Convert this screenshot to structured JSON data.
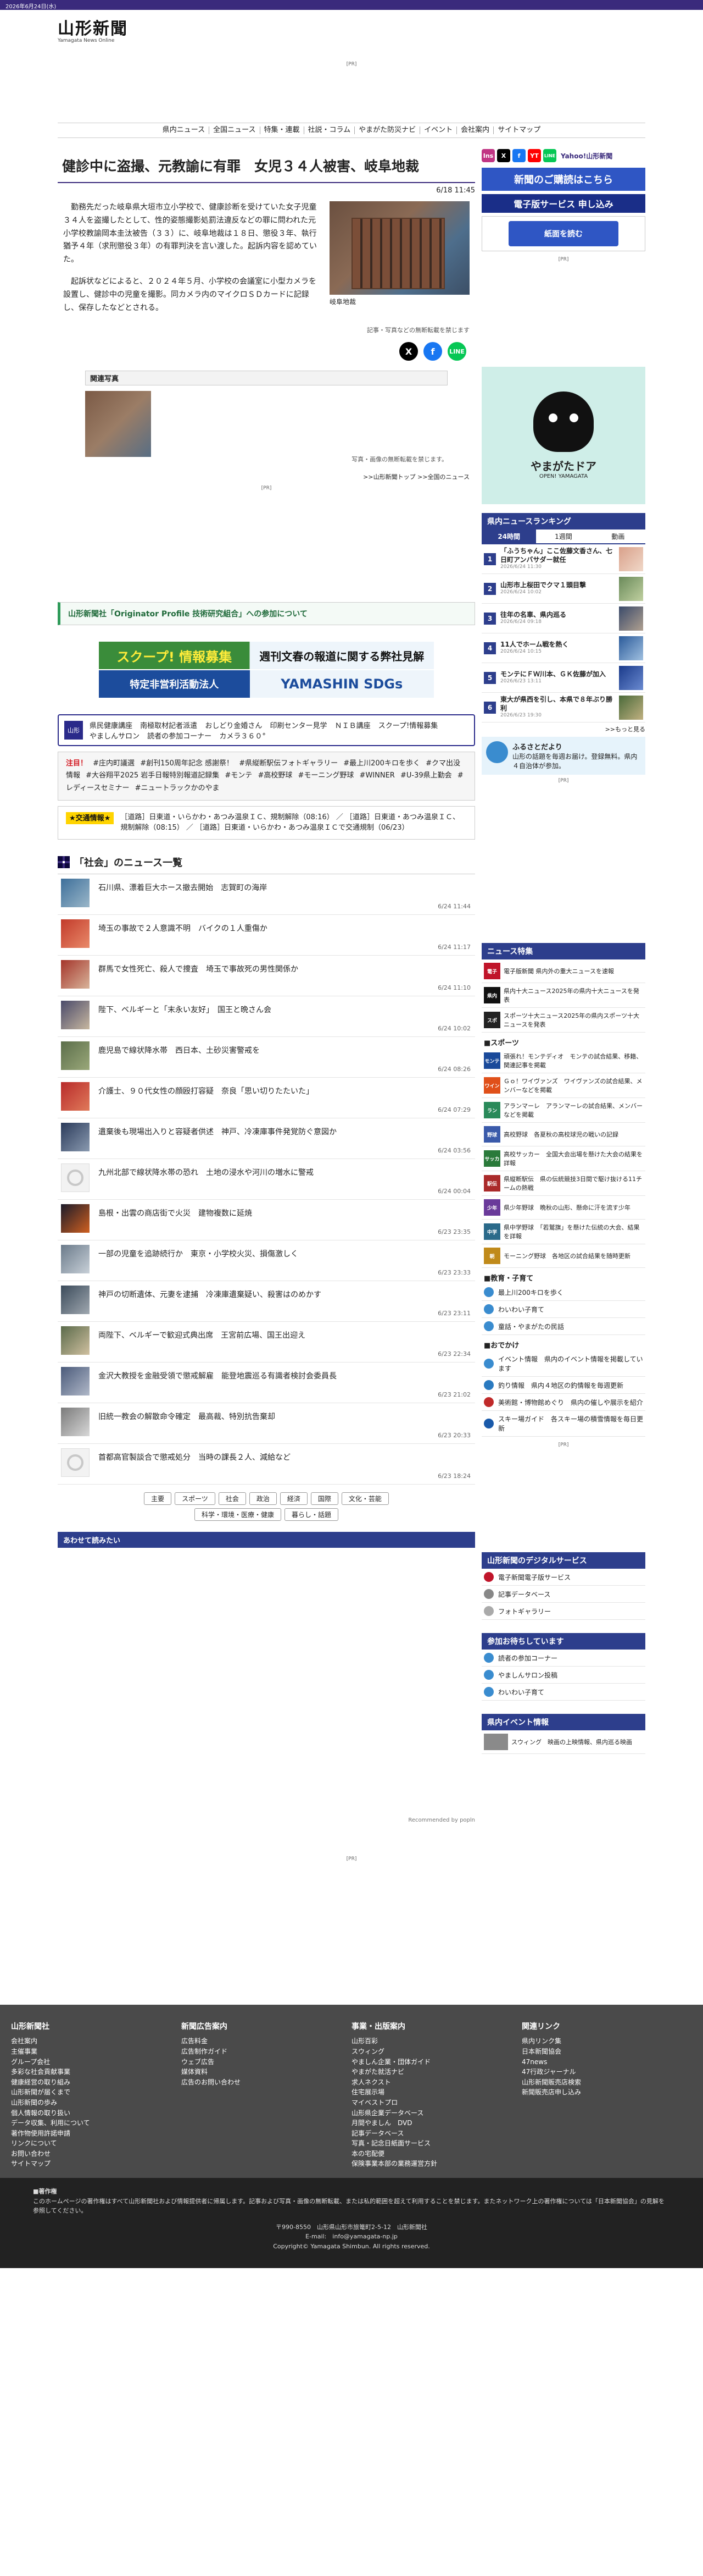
{
  "topbar": {
    "date": "2026年6月24日(水)"
  },
  "masthead": {
    "logo": "山形新聞",
    "logo_sub": "Yamagata News Online"
  },
  "pr_label": "[PR]",
  "nav": [
    "県内ニュース",
    "全国ニュース",
    "特集・連載",
    "社説・コラム",
    "やまがた防災ナビ",
    "イベント",
    "会社案内",
    "サイトマップ"
  ],
  "article": {
    "title": "健診中に盗撮、元教諭に有罪　女児３４人被害、岐阜地裁",
    "date": "6/18 11:45",
    "paragraphs": [
      "勤務先だった岐阜県大垣市立小学校で、健康診断を受けていた女子児童３４人を盗撮したとして、性的姿態撮影処罰法違反などの罪に問われた元小学校教諭岡本圭汰被告（３３）に、岐阜地裁は１８日、懲役３年、執行猶予４年（求刑懲役３年）の有罪判決を言い渡した。起訴内容を認めていた。",
      "起訴状などによると、２０２４年５月、小学校の会議室に小型カメラを設置し、健診中の児童を撮影。同カメラ内のマイクロＳＤカードに記録し、保存したなどとされる。"
    ],
    "photo_caption": "岐阜地裁",
    "photo_note": "記事・写真などの無断転載を禁じます"
  },
  "related": {
    "head": "関連写真",
    "note": "写真・画像の無断転載を禁じます。",
    "back": ">>山形新聞トップ >>全国のニュース"
  },
  "notice": "山形新聞社「Originator Profile 技術研究組合」への参加について",
  "banner1": {
    "left": "スクープ! 情報募集",
    "right": "週刊文春の報道に関する弊社見解"
  },
  "banner2": {
    "left": "特定非営利活動法人",
    "right": "YAMASHIN SDGs"
  },
  "service_box": {
    "icon": "山形",
    "links": [
      "県民健康講座",
      "南極取材記者派遣",
      "おしどり金婚さん",
      "印刷センター見学",
      "ＮＩＢ講座",
      "スクープ!情報募集",
      "やましんサロン",
      "読者の参加コーナー",
      "カメラ３６０°"
    ]
  },
  "tags": {
    "hot": "注目！",
    "items": [
      "#庄内町議選",
      "#創刊150周年記念 感謝祭！",
      "#県縦断駅伝フォトギャラリー",
      "#最上川200キロを歩く",
      "#クマ出没情報",
      "#大谷翔平2025 岩手日報特別報道記録集",
      "#モンテ",
      "#高校野球",
      "#モーニング野球",
      "#WINNER",
      "#U-39県上勤会",
      "#レディースセミナー",
      "#ニュートラックかのやま"
    ]
  },
  "traffic": {
    "label": "★交通情報★",
    "text": "［道路］日東道・いらかわ・あつみ温泉ＩＣ、規制解除（08:16） ／ ［道路］日東道・あつみ温泉ＩＣ、規制解除（08:15） ／ ［道路］日東道・いらかわ・あつみ温泉ＩＣで交通規制（06/23）"
  },
  "newslist": {
    "head": "「社会」のニュース一覧",
    "items": [
      {
        "title": "石川県、漂着巨大ホース撤去開始　志賀町の海岸",
        "date": "6/24 11:44"
      },
      {
        "title": "埼玉の事故で２人意識不明　バイクの１人重傷か",
        "date": "6/24 11:17"
      },
      {
        "title": "群馬で女性死亡、殺人で捜査　埼玉で事故死の男性関係か",
        "date": "6/24 11:10"
      },
      {
        "title": "陛下、ベルギーと「末永い友好」　国王と晩さん会",
        "date": "6/24 10:02"
      },
      {
        "title": "鹿児島で線状降水帯　西日本、土砂災害警戒を",
        "date": "6/24 08:26"
      },
      {
        "title": "介護士、９０代女性の顔殴打容疑　奈良「思い切りたたいた」",
        "date": "6/24 07:29"
      },
      {
        "title": "遺棄後も現場出入りと容疑者供述　神戸、冷凍庫事件発覚防ぐ意図か",
        "date": "6/24 03:56"
      },
      {
        "title": "九州北部で線状降水帯の恐れ　土地の浸水や河川の増水に警戒",
        "date": "6/24 00:04"
      },
      {
        "title": "島根・出雲の商店街で火災　建物複数に延焼",
        "date": "6/23 23:35"
      },
      {
        "title": "一部の児童を追跡続行か　東京・小学校火災、損傷激しく",
        "date": "6/23 23:33"
      },
      {
        "title": "神戸の切断遺体、元妻を逮捕　冷凍庫遺棄疑い、殺害はのめかす",
        "date": "6/23 23:11"
      },
      {
        "title": "両陛下、ベルギーで歓迎式典出席　王宮前広場、国王出迎え",
        "date": "6/23 22:34"
      },
      {
        "title": "金沢大教授を金融受領で懲戒解雇　能登地震巡る有識者検討会委員長",
        "date": "6/23 21:02"
      },
      {
        "title": "旧統一教会の解散命令確定　最高裁、特別抗告棄却",
        "date": "6/23 20:33"
      },
      {
        "title": "首都高官製談合で懲戒処分　当時の課長２人、減給など",
        "date": "6/23 18:24"
      }
    ]
  },
  "categories": [
    "主要",
    "スポーツ",
    "社会",
    "政治",
    "経済",
    "国際",
    "文化・芸能",
    "科学・環境・医療・健康",
    "暮らし・話題"
  ],
  "together": "あわせて読みたい",
  "recommend": "Recommended by popln",
  "side": {
    "sns": [
      "Ins",
      "X",
      "f",
      "YT",
      "LINE"
    ],
    "sns_text": "Yahoo!山形新聞",
    "ad1": "新聞のご購読はこちら",
    "ad2": "電子版サービス 申し込み",
    "ad3": "紙面を読む",
    "doa_title": "やまがたドア",
    "doa_sub": "OPEN! YAMAGATA",
    "rank_head": "県内ニュースランキング",
    "rank_tabs": [
      "24時間",
      "1週間",
      "動画"
    ],
    "ranking": [
      {
        "title": "「ふうちゃん」ここ佐藤文香さん、七日町アンバサダー就任",
        "date": "2026/6/24 11:30"
      },
      {
        "title": "山形市上桜田でクマ１頭目撃",
        "date": "2026/6/24 10:02"
      },
      {
        "title": "往年の名車、県内巡る",
        "date": "2026/6/24 09:18"
      },
      {
        "title": "11人でホーム戦を熱く",
        "date": "2026/6/24 10:15"
      },
      {
        "title": "モンテにＦＷ川本、ＧＫ佐藤が加入",
        "date": "2026/6/23 13:11"
      },
      {
        "title": "東大が県西を引し、本県で８年ぶり勝利",
        "date": "2026/6/23 19:30"
      }
    ],
    "more": ">>もっと見る",
    "furusato_title": "ふるさとだより",
    "furusato_text": "山形の話題を毎週お届け。登録無料。県内４自治体が参加。",
    "feature_head": "ニュース特集",
    "features": [
      {
        "icon": "電子",
        "text": "電子版新聞 県内外の重大ニュースを速報"
      },
      {
        "icon": "県内",
        "text": "県内十大ニュース2025年の県内十大ニュースを発表"
      },
      {
        "icon": "スポ",
        "text": "スポーツ十大ニュース2025年の県内スポーツ十大ニュースを発表"
      }
    ],
    "sports_head": "■スポーツ",
    "sports": [
      {
        "icon": "モンテ",
        "text": "頑張れ！モンテディオ　モンテの試合結果、移籍、関連記事を掲載"
      },
      {
        "icon": "ワイン",
        "text": "Ｇｏ！ワイヴァンズ　ワイヴァンズの試合結果、メンバーなどを掲載"
      },
      {
        "icon": "ラン",
        "text": "アランマーレ　アランマーレの試合結果、メンバーなどを掲載"
      },
      {
        "icon": "野球",
        "text": "高校野球　各夏秋の高校球児の戦いの記録"
      },
      {
        "icon": "サッカ",
        "text": "高校サッカー　全国大会出場を懸けた大会の結果を詳報"
      },
      {
        "icon": "駅伝",
        "text": "県縦断駅伝　県の伝統競技3日間で駆け抜ける11チームの熱戦"
      },
      {
        "icon": "少年",
        "text": "県少年野球　晩秋の山形、懸命に汗を流す少年"
      },
      {
        "icon": "中学",
        "text": "県中学野球　「若鷲旗」を懸けた伝統の大会、結果を詳報"
      },
      {
        "icon": "朝",
        "text": "モーニング野球　各地区の試合結果を随時更新"
      }
    ],
    "edu_head": "■教育・子育て",
    "edu": [
      "最上川200キロを歩く",
      "わいわい子育て",
      "童話・やまがたの民話"
    ],
    "out_head": "■おでかけ",
    "out": [
      {
        "text": "イベント情報　県内のイベント情報を掲載しています"
      },
      {
        "text": "釣り情報　県内４地区の釣情報を毎週更新"
      },
      {
        "text": "美術館・博物館めぐり　県内の催しや展示を紹介"
      },
      {
        "text": "スキー場ガイド　各スキー場の積雪情報を毎日更新"
      }
    ],
    "digital_head": "山形新聞のデジタルサービス",
    "digital": [
      "電子新聞電子版サービス",
      "記事データベース",
      "フォトギャラリー"
    ],
    "join_head": "参加お待ちしています",
    "join": [
      "読者の参加コーナー",
      "やましんサロン投稿",
      "わいわい子育て"
    ],
    "event_head": "県内イベント情報",
    "event_item": "スウィング　映画の上映情報、県内巡る映画"
  },
  "footer": {
    "cols": [
      {
        "head": "山形新聞社",
        "items": [
          "会社案内",
          "主催事業",
          "グループ会社",
          "多彩な社会貢献事業",
          "健康経営の取り組み",
          "山形新聞が届くまで",
          "山形新聞の歩み",
          "個人情報の取り扱い",
          "データ収集、利用について",
          "著作物使用許諾申請",
          "リンクについて",
          "お問い合わせ",
          "サイトマップ"
        ]
      },
      {
        "head": "新聞広告案内",
        "items": [
          "広告料金",
          "広告制作ガイド",
          "ウェブ広告",
          "媒体資料",
          "広告のお問い合わせ"
        ]
      },
      {
        "head": "事業・出版案内",
        "items": [
          "山形百彩",
          "スウィング",
          "やましん企業・団体ガイド",
          "やまがた就活ナビ",
          "求人ネクスト",
          "住宅展示場",
          "マイベストプロ",
          "山形県企業データベース",
          "月間やましん　DVD",
          "記事データベース",
          "写真・記念日紙面サービス",
          "本の宅配便",
          "保険事業本部の業務運営方針"
        ]
      },
      {
        "head": "関連リンク",
        "items": [
          "県内リンク集",
          "日本新聞協会",
          "47news",
          "47行政ジャーナル",
          "山形新聞販売店検索",
          "新聞販売店申し込み"
        ]
      }
    ],
    "copyright_head": "■著作権",
    "copyright_text": "このホームページの著作権はすべて山形新聞社および情報提供者に帰属します。記事および写真・画像の無断転載、または私的範囲を超えて利用することを禁じます。またネットワーク上の著作権については「日本新聞協会」の見解を参照してください。",
    "address": "〒990-8550　山形県山形市旅篭町2-5-12　山形新聞社",
    "email": "E-mail:　info@yamagata-np.jp",
    "copy": "Copyright© Yamagata Shimbun. All rights reserved."
  }
}
